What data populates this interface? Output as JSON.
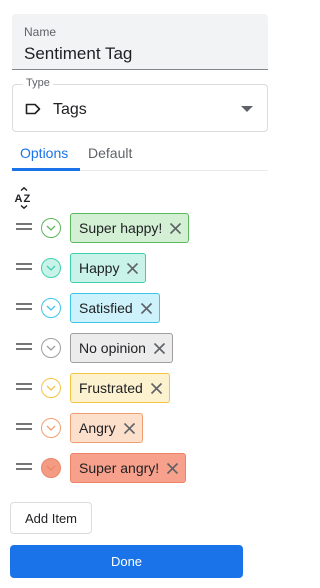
{
  "name_field": {
    "label": "Name",
    "value": "Sentiment Tag"
  },
  "type_field": {
    "label": "Type",
    "value": "Tags",
    "icon": "tag-icon"
  },
  "tabs": [
    {
      "label": "Options",
      "active": true
    },
    {
      "label": "Default",
      "active": false
    }
  ],
  "sort_icon": "sort-az-icon",
  "options": [
    {
      "label": "Super happy!",
      "dot_border": "#5cb85c",
      "dot_fill": "#ffffff",
      "chip_bg": "#d4f0d4",
      "chip_border": "#5cb85c"
    },
    {
      "label": "Happy",
      "dot_border": "#3fd0b0",
      "dot_fill": "#c9f3e8",
      "chip_bg": "#c9f3e8",
      "chip_border": "#3fd0b0"
    },
    {
      "label": "Satisfied",
      "dot_border": "#3dc5e8",
      "dot_fill": "#ffffff",
      "chip_bg": "#cdf2fb",
      "chip_border": "#3dc5e8"
    },
    {
      "label": "No opinion",
      "dot_border": "#9e9e9e",
      "dot_fill": "#ffffff",
      "chip_bg": "#ececec",
      "chip_border": "#9e9e9e"
    },
    {
      "label": "Frustrated",
      "dot_border": "#f5c342",
      "dot_fill": "#ffffff",
      "chip_bg": "#fdf2cf",
      "chip_border": "#f5c342"
    },
    {
      "label": "Angry",
      "dot_border": "#f0a070",
      "dot_fill": "#ffffff",
      "chip_bg": "#fde0cc",
      "chip_border": "#f0a070"
    },
    {
      "label": "Super angry!",
      "dot_border": "#ec8468",
      "dot_fill": "#f49b84",
      "chip_bg": "#f7a08b",
      "chip_border": "#ec8468"
    }
  ],
  "buttons": {
    "add_item": "Add Item",
    "done": "Done"
  },
  "colors": {
    "accent": "#1a73e8"
  }
}
